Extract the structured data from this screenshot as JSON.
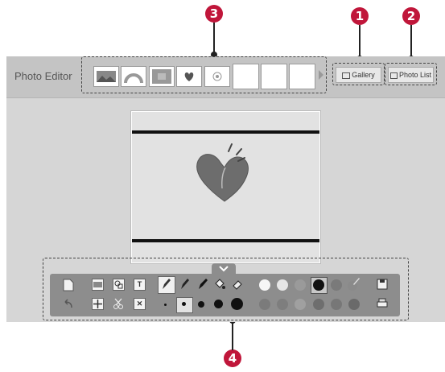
{
  "app": {
    "title": "Photo Editor"
  },
  "buttons": {
    "gallery": "Gallery",
    "photo_list": "Photo List"
  },
  "callouts": {
    "c1": "1",
    "c2": "2",
    "c3": "3",
    "c4": "4"
  },
  "toolbar": {
    "text_tool": "T",
    "close_tool": "✕"
  },
  "colors": {
    "accent_callout": "#c0163a",
    "heart": "#6d6d6d",
    "toolbar": "#8d8d8d",
    "screen": "#d6d6d6"
  }
}
